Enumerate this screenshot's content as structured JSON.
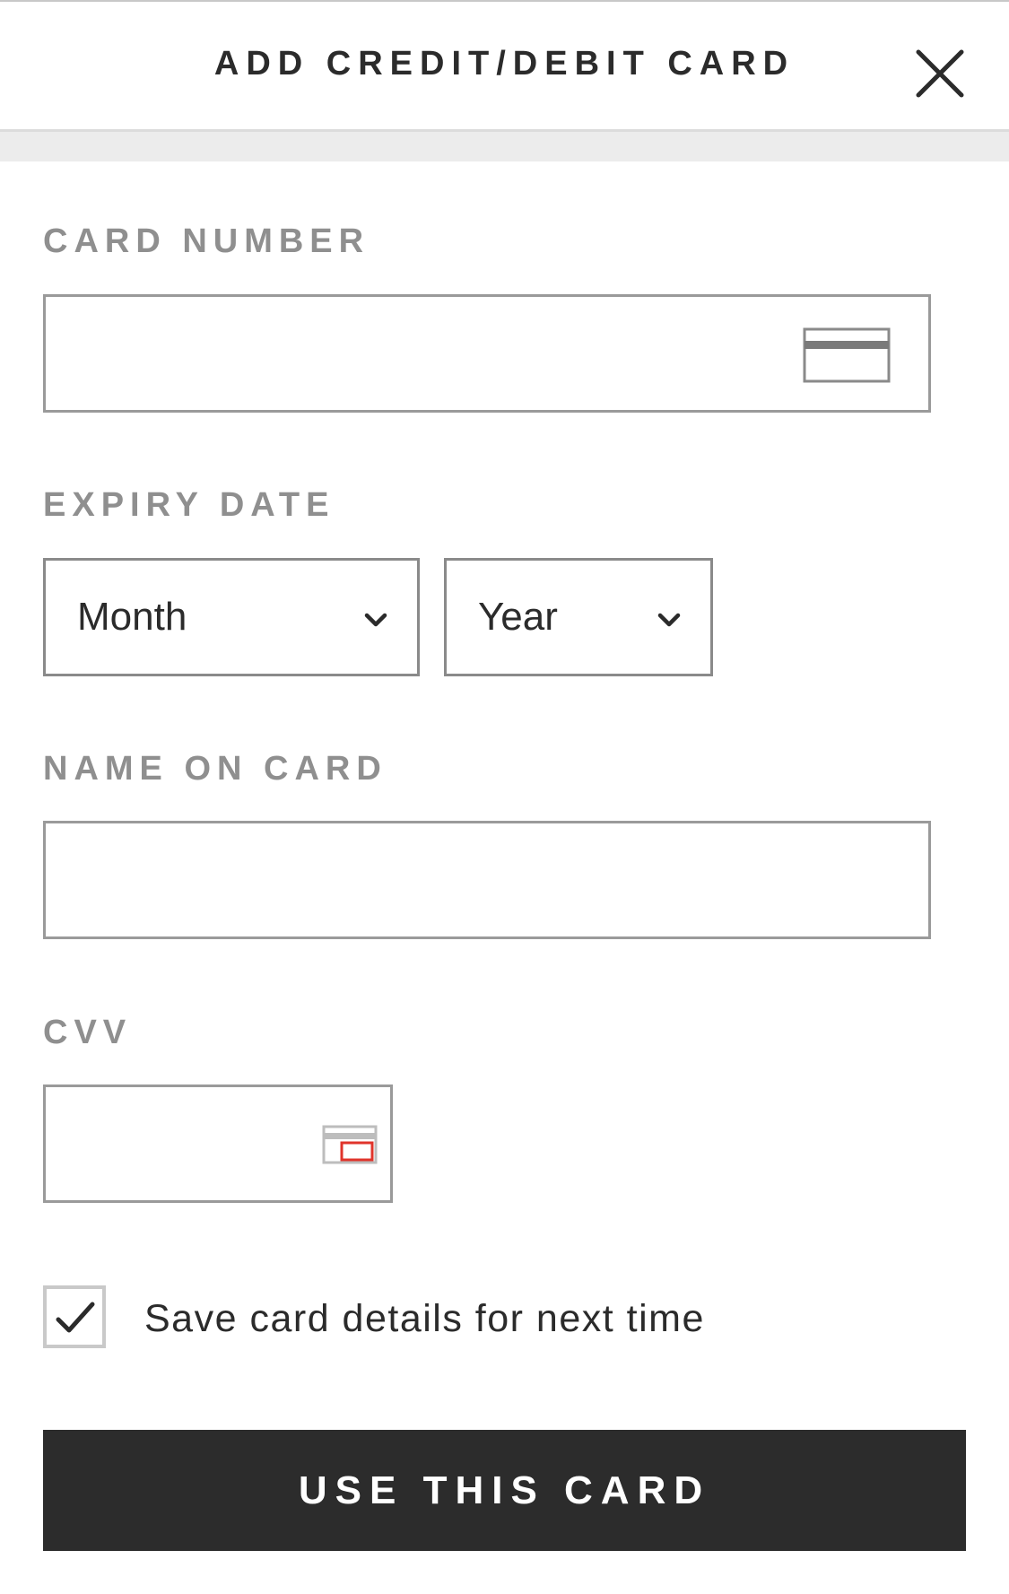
{
  "header": {
    "title": "ADD CREDIT/DEBIT CARD",
    "close_icon": "close-icon"
  },
  "card_number": {
    "label": "CARD NUMBER",
    "value": "",
    "icon": "credit-card-icon"
  },
  "expiry": {
    "label": "EXPIRY DATE",
    "month": {
      "selected": "Month",
      "icon": "chevron-down-icon"
    },
    "year": {
      "selected": "Year",
      "icon": "chevron-down-icon"
    }
  },
  "name_on_card": {
    "label": "NAME ON CARD",
    "value": ""
  },
  "cvv": {
    "label": "CVV",
    "value": "",
    "icon": "card-cvv-icon"
  },
  "save_card": {
    "label": "Save card details for next time",
    "checked": true,
    "icon": "checkmark-icon"
  },
  "submit": {
    "label": "USE THIS CARD"
  },
  "colors": {
    "button_bg": "#2c2c2c",
    "label_gray": "#8f8f8f",
    "border_gray": "#9a9a9a",
    "cvv_accent": "#e0342b"
  }
}
